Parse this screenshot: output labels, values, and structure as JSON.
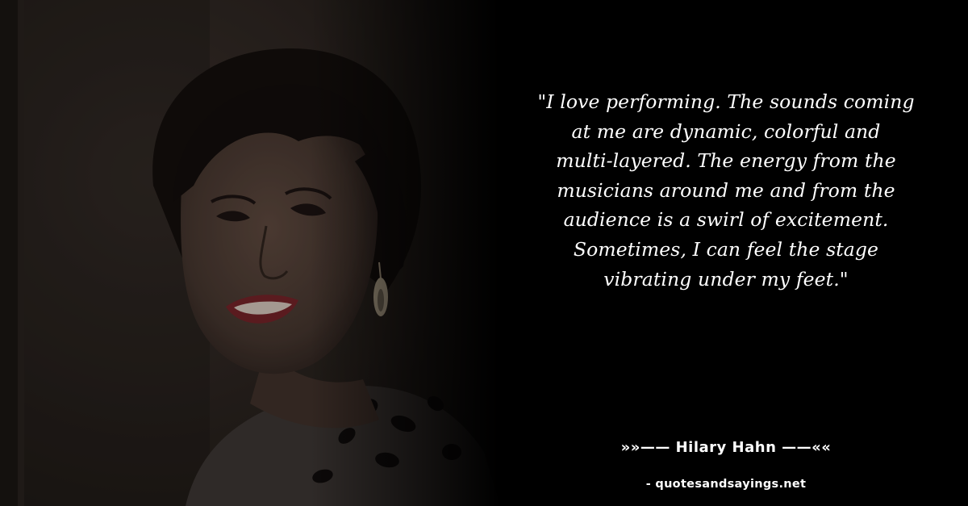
{
  "quote": {
    "text": "\"I love performing. The sounds coming at me are dynamic, colorful and multi-layered. The energy from the musicians around me and from the audience is a swirl of excitement. Sometimes, I can feel the stage vibrating under my feet.\"",
    "lines": [
      "\"I love performing. The sounds coming",
      "at me are dynamic, colorful and",
      "multi-layered. The energy from the",
      "musicians around me and from the",
      "audience is a swirl of excitement.",
      "Sometimes, I can feel the stage",
      "vibrating under my feet.\""
    ]
  },
  "author": {
    "label": "»»—— Hilary Hahn ——««"
  },
  "source": {
    "label": "- quotesandsayings.net"
  },
  "photo": {
    "subject": "smiling woman with dark hair, earring and patterned top",
    "colors": {
      "background": "#000000",
      "wall": "#2b2420",
      "skin": "#4a3a33",
      "hair": "#140f0d",
      "lips": "#6e2127",
      "text": "#ffffff"
    }
  }
}
